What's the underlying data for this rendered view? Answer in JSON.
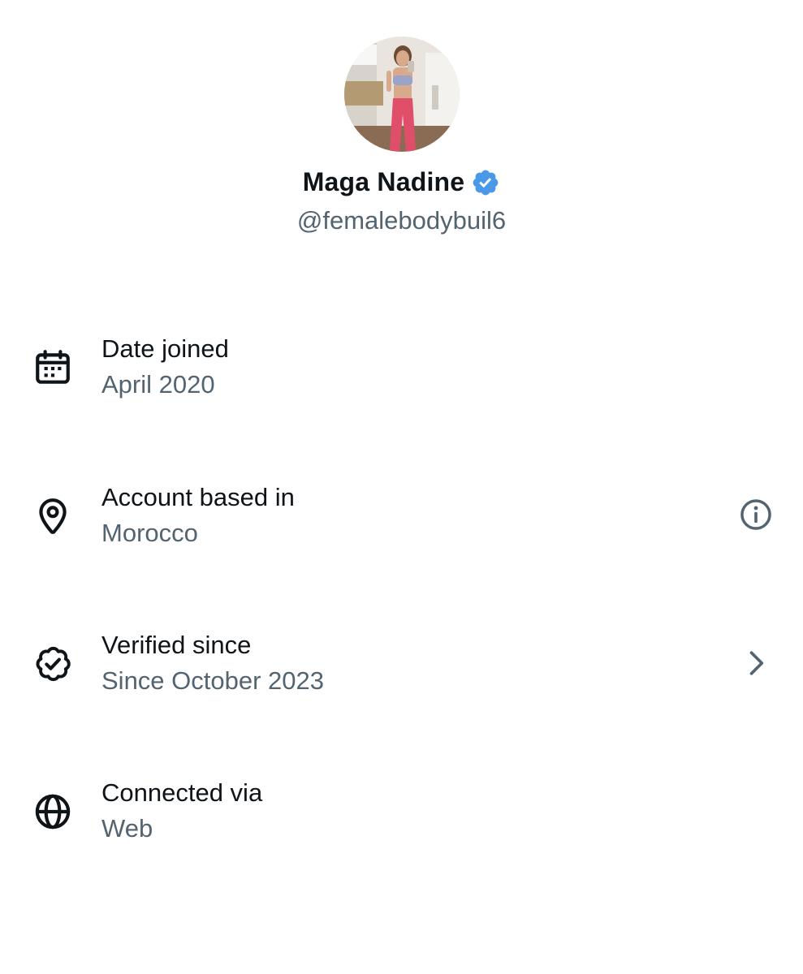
{
  "profile": {
    "display_name": "Maga Nadine",
    "handle": "@femalebodybuil6",
    "verified": true,
    "badge_color": "#4a99e9"
  },
  "about": {
    "rows": [
      {
        "icon": "calendar-icon",
        "title": "Date joined",
        "value": "April 2020",
        "trailing": null
      },
      {
        "icon": "location-pin-icon",
        "title": "Account based in",
        "value": "Morocco",
        "trailing": "info-icon"
      },
      {
        "icon": "verified-badge-icon",
        "title": "Verified since",
        "value": "Since October 2023",
        "trailing": "chevron-right-icon"
      },
      {
        "icon": "globe-icon",
        "title": "Connected via",
        "value": "Web",
        "trailing": null
      }
    ]
  },
  "colors": {
    "primary_text": "#0f1419",
    "secondary_text": "#536471"
  }
}
